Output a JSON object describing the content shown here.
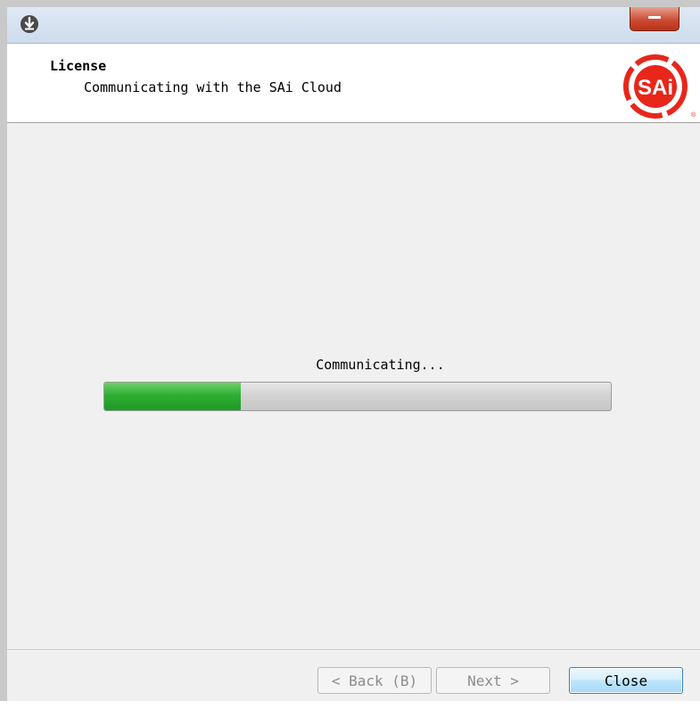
{
  "window": {
    "close_icon": "close-icon",
    "app_icon": "download-icon"
  },
  "header": {
    "title": "License",
    "subtitle": "Communicating with the SAi Cloud",
    "logo_text": "SAi",
    "logo_color": "#e8261a"
  },
  "status": {
    "text": "Communicating...",
    "progress": 0.27,
    "progress_color": "#2fae34"
  },
  "footer": {
    "back_label": "< Back (B)",
    "next_label": "Next >",
    "close_label": "Close"
  }
}
